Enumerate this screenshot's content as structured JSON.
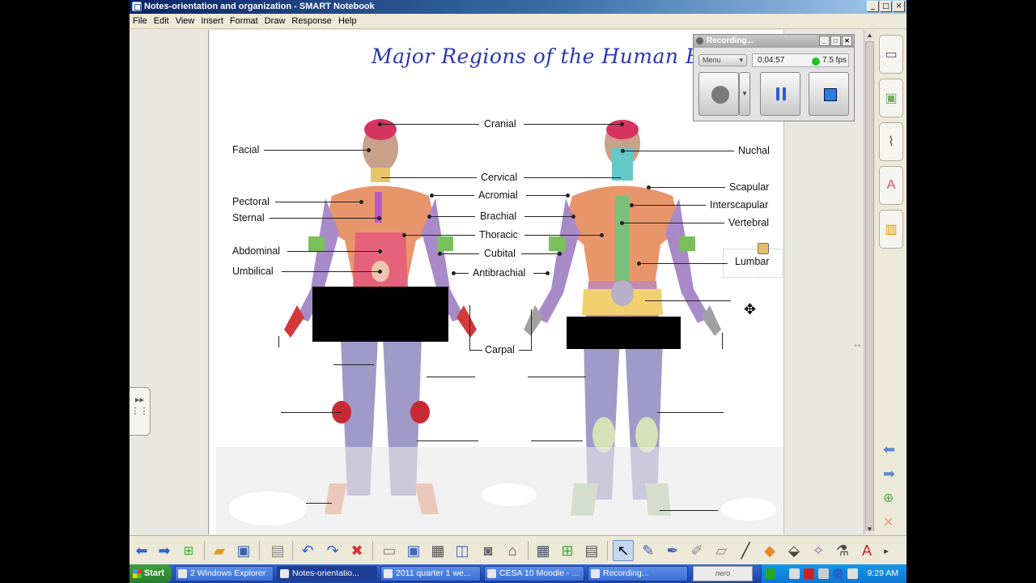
{
  "window": {
    "title": "Notes-orientation and organization - SMART Notebook",
    "buttons": [
      "_",
      "□",
      "✕"
    ]
  },
  "menu": [
    "File",
    "Edit",
    "View",
    "Insert",
    "Format",
    "Draw",
    "Response",
    "Help"
  ],
  "slide": {
    "title": "Major Regions of the Human Body",
    "anterior_labels": {
      "facial": "Facial",
      "pectoral": "Pectoral",
      "sternal": "Sternal",
      "abdominal": "Abdominal",
      "umbilical": "Umbilical"
    },
    "center_labels": {
      "cranial": "Cranial",
      "cervical": "Cervical",
      "acromial": "Acromial",
      "brachial": "Brachial",
      "thoracic": "Thoracic",
      "cubital": "Cubital",
      "antibrachial": "Antibrachial",
      "carpal": "Carpal"
    },
    "posterior_labels": {
      "nuchal": "Nuchal",
      "scapular": "Scapular",
      "interscapular": "Interscapular",
      "vertebral": "Vertebral",
      "lumbar": "Lumbar"
    }
  },
  "recorder": {
    "title": "Recording...",
    "menu_label": "Menu",
    "elapsed": "0:04:57",
    "fps": "7.5 fps",
    "fps_status_color": "#1dc51d"
  },
  "sidebar": [
    "page-sorter-icon",
    "gallery-icon",
    "attachments-icon",
    "properties-icon",
    "addons-icon"
  ],
  "toolbar": [
    "back-icon",
    "forward-icon",
    "add-page-icon",
    "open-icon",
    "save-icon",
    "paste-icon",
    "undo-icon",
    "redo-icon",
    "delete-icon",
    "screen-shade-icon",
    "full-screen-icon",
    "transparent-bg-icon",
    "dual-page-icon",
    "capture-icon",
    "document-camera-icon",
    "table-icon",
    "insert-icon",
    "response-icon",
    "select-icon",
    "pen-icon",
    "creative-pen-icon",
    "highlighter-icon",
    "eraser-icon",
    "line-icon",
    "shape-icon",
    "fill-icon",
    "magic-pen-icon",
    "text-icon"
  ],
  "taskbar": {
    "start": "Start",
    "tasks": [
      "2 Windows Explorer",
      "Notes-orientatio...",
      "2011 quarter 1 we...",
      "CESA 10 Moodle - ...",
      "Recording..."
    ],
    "nero_label": "nero",
    "clock": "9:29 AM"
  }
}
